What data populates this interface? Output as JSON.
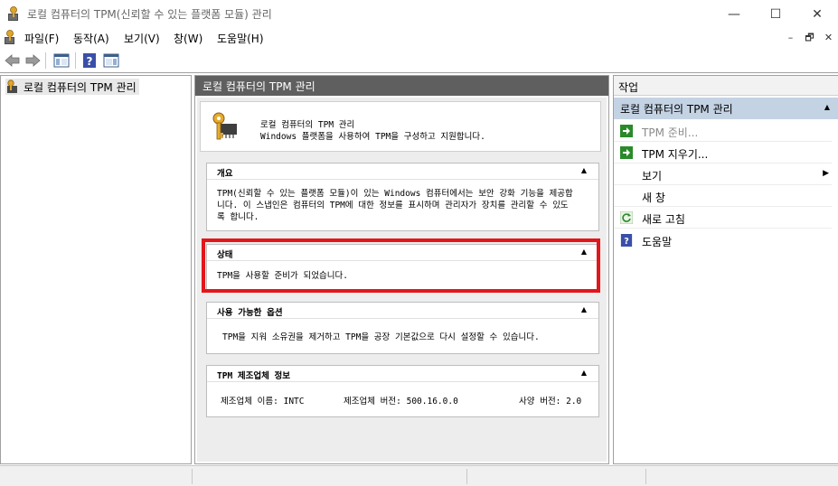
{
  "window": {
    "title": "로컬 컴퓨터의 TPM(신뢰할 수 있는 플랫폼 모듈) 관리",
    "minimize": "—",
    "maximize": "☐",
    "close": "✕"
  },
  "menu": {
    "items": [
      "파일(F)",
      "동작(A)",
      "보기(V)",
      "창(W)",
      "도움말(H)"
    ],
    "mdi": [
      "–",
      "🗗",
      "✕"
    ]
  },
  "tree": {
    "root_label": "로컬 컴퓨터의 TPM 관리"
  },
  "center": {
    "header": "로컬 컴퓨터의 TPM 관리",
    "intro": {
      "line1": "로컬 컴퓨터의 TPM 관리",
      "line2": "Windows 플랫폼을 사용하여 TPM을 구성하고 지원합니다."
    },
    "sections": {
      "overview": {
        "title": "개요",
        "lines": [
          "TPM(신뢰할 수 있는 플랫폼 모듈)이 있는 Windows 컴퓨터에서는 보안 강화 기능을 제공합",
          "니다. 이 스냅인은 컴퓨터의 TPM에 대한 정보를 표시하며 관리자가 장치를 관리할 수 있도",
          "록 합니다."
        ]
      },
      "status": {
        "title": "상태",
        "text": "TPM을 사용할 준비가 되었습니다."
      },
      "options": {
        "title": "사용 가능한 옵션",
        "text": "TPM을 지워 소유권을 제거하고 TPM을 공장 기본값으로 다시 설정할 수 있습니다."
      },
      "manufacturer": {
        "title": "TPM 제조업체 정보",
        "name_label": "제조업체 이름: INTC",
        "version_label": "제조업체 버전: 500.16.0.0",
        "spec_label": "사양 버전: 2.0"
      }
    }
  },
  "actions": {
    "header": "작업",
    "group": "로컬 컴퓨터의 TPM 관리",
    "items": [
      {
        "label": "TPM 준비...",
        "disabled": true
      },
      {
        "label": "TPM 지우기...",
        "disabled": false
      },
      {
        "label": "보기",
        "disabled": false
      },
      {
        "label": "새 창",
        "disabled": false
      },
      {
        "label": "새로 고침",
        "disabled": false
      },
      {
        "label": "도움말",
        "disabled": false
      }
    ]
  },
  "colors": {
    "highlight_border": "#e3161b",
    "center_header_bg": "#5f5f5f",
    "action_group_bg": "#c4d3e4",
    "action_green": "#2a8a2a",
    "help_blue": "#3a4fa8"
  }
}
